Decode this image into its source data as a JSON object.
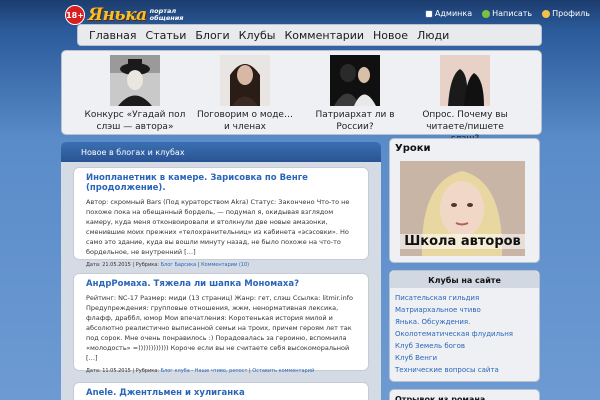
{
  "header": {
    "age_badge": "18+",
    "brand": "Янька",
    "brand_sub_1": "портал",
    "brand_sub_2": "общения",
    "links": [
      "Админка",
      "Написать",
      "Профиль"
    ]
  },
  "nav": {
    "items": [
      "Главная",
      "Статьи",
      "Блоги",
      "Клубы",
      "Комментарии",
      "Новое",
      "Люди"
    ]
  },
  "featured": [
    {
      "title": "Конкурс «Угадай пол слэш — автора»"
    },
    {
      "title": "Поговорим о моде… и членах"
    },
    {
      "title": "Патриархат ли в России?"
    },
    {
      "title": "Опрос. Почему вы читаете/пишете слэш?"
    }
  ],
  "main": {
    "heading": "Новое в блогах и клубах",
    "posts": [
      {
        "title": "Инопланетник в камере. Зарисовка по Венге (продолжение).",
        "body": "Автор: скромный Bars (Под кураторством Akra) Статус: Закончено   Что-то не похоже пока на обещанный бордель, — подумал я, окидывая взглядом камеру, куда меня отконвоировали и втолкнули две новые амазонки, сменившие моих прежних «телохранительниц» из кабинета «эсэсовки». Но само это здание, куда вы вошли минуту назад, не было похоже на что-то бордельное, не внутренний […]",
        "date": "Дата: 21.05.2015",
        "rubric": "Рубрика:",
        "link1": "Блог Барсика",
        "link2": "Комментарии (10)"
      },
      {
        "title": "АндрРомаха. Тяжела ли шапка Мономаха?",
        "body": "Рейтинг: NC-17 Размер: миди (13 страниц) Жанр: гет, слэш Ссылка: litmir.info Предупреждения: групповые отношения, жжм, ненормативная лексика, флафф, драббл, юмор Мои впечатления: Коротенькая история милой и абсолютно реалистично выписанной семьи на троих, причем героям лет так под сорок. Мне очень понравилось :) Порадовалась за героиню, вспомнила «молодость» =)))))))))))) Короче если вы не считаете себя высокоморальной […]",
        "date": "Дата: 11.05.2015",
        "rubric": "Рубрика:",
        "link1": "Блог клуба - Наше чтиво, репост",
        "link2": "Оставить комментарий"
      },
      {
        "title": "Anele. Джентльмен и хулиганка"
      }
    ]
  },
  "sidebar": {
    "lessons_title": "Уроки",
    "lessons_caption": "Школа авторов",
    "clubs_title": "Клубы на сайте",
    "clubs": [
      "Писательская гильдия",
      "Матриархальное чтиво",
      "Янька. Обсуждения.",
      "Околотематическая флудильня",
      "Клуб Земель богов",
      "Клуб Венги",
      "Технические вопросы сайта"
    ],
    "next_title": "Отрывок из романа"
  },
  "colors": {
    "brand_yellow": "#f2c22a",
    "link_blue": "#2a66b8",
    "header_blue": "#2a5494"
  }
}
